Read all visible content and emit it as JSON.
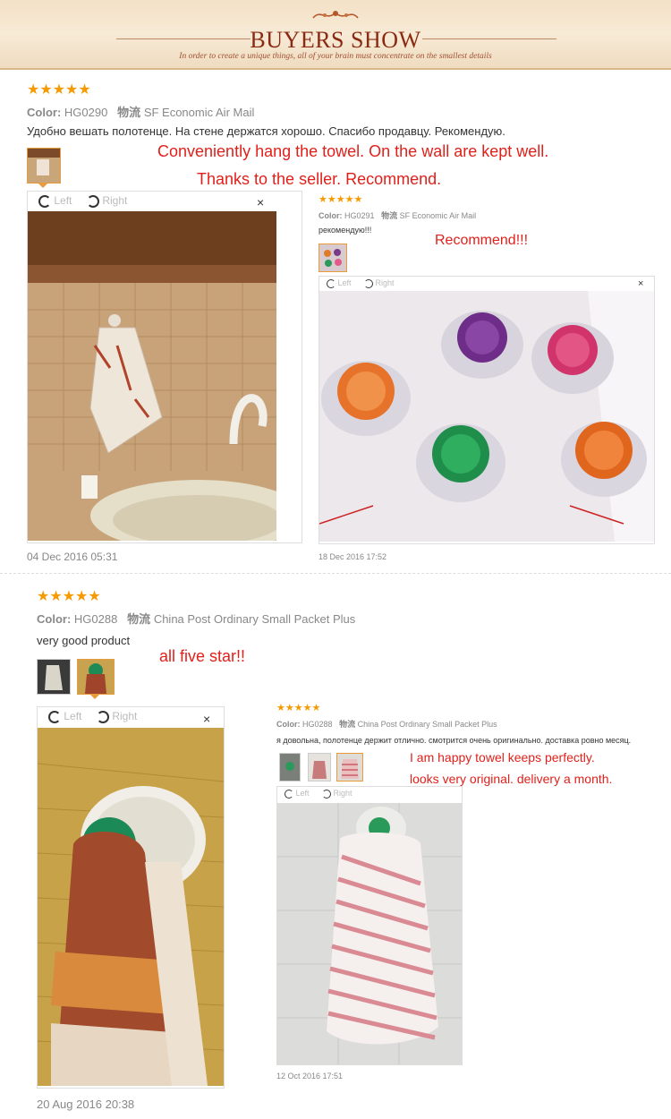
{
  "banner": {
    "title": "BUYERS SHOW",
    "subtitle": "In order to create a unique things, all of your brain must concentrate on the smallest details"
  },
  "colors": {
    "star": "#f59b00",
    "red_text": "#e0211b",
    "banner_bg": "#f3e1c6",
    "banner_title": "#8b2a12"
  },
  "viewer": {
    "left_label": "Left",
    "right_label": "Right",
    "close": "×"
  },
  "reviews": [
    {
      "stars": "★★★★★",
      "color_label": "Color:",
      "color_value": "HG0290",
      "logistics_label": "物流",
      "logistics_value": "SF Economic Air Mail",
      "text": "Удобно вешать полотенце. На стене держатся хорошо. Спасибо продавцу. Рекомендую.",
      "translation_1": "Conveniently  hang  the  towel.  On  the  wall  are  kept  well.",
      "translation_2": "Thanks  to  the  seller.  Recommend.",
      "date": "04 Dec 2016 05:31"
    },
    {
      "stars": "★★★★★",
      "color_label": "Color:",
      "color_value": "HG0291",
      "logistics_label": "物流",
      "logistics_value": "SF Economic Air Mail",
      "text": "рекомендую!!!",
      "translation_1": "Recommend!!!",
      "date": "18 Dec 2016 17:52"
    },
    {
      "stars": "★★★★★",
      "color_label": "Color:",
      "color_value": "HG0288",
      "logistics_label": "物流",
      "logistics_value": "China Post Ordinary Small Packet Plus",
      "text": "very good product",
      "translation_1": "all  five  star!!",
      "date": "20 Aug 2016 20:38"
    },
    {
      "stars": "★★★★★",
      "color_label": "Color:",
      "color_value": "HG0288",
      "logistics_label": "物流",
      "logistics_value": "China Post Ordinary Small Packet Plus",
      "text": "я довольна, полотенце держит отлично. смотрится очень оригинально. доставка ровно месяц.",
      "translation_1": "I  am  happy  towel  keeps  perfectly.",
      "translation_2": "looks  very  original.  delivery  a  month.",
      "date": "12 Oct 2016 17:51"
    }
  ]
}
